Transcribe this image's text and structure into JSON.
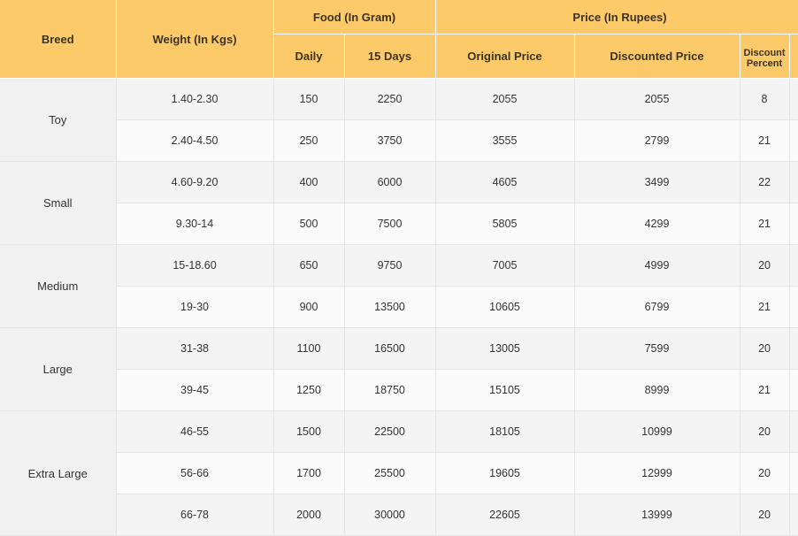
{
  "header": {
    "breed": "Breed",
    "weight": "Weight (In Kgs)",
    "food_group": "Food (In Gram)",
    "price_group": "Price (In Rupees)",
    "daily": "Daily",
    "fifteen_days": "15 Days",
    "original_price": "Original Price",
    "discounted_price": "Discounted Price",
    "discount_percent_line1": "Discount",
    "discount_percent_line2": "Percent"
  },
  "groups": [
    {
      "breed": "Toy",
      "rows": [
        {
          "weight": "1.40-2.30",
          "daily": "150",
          "days15": "2250",
          "original": "2055",
          "discounted": "2055",
          "discount": "8"
        },
        {
          "weight": "2.40-4.50",
          "daily": "250",
          "days15": "3750",
          "original": "3555",
          "discounted": "2799",
          "discount": "21"
        }
      ]
    },
    {
      "breed": "Small",
      "rows": [
        {
          "weight": "4.60-9.20",
          "daily": "400",
          "days15": "6000",
          "original": "4605",
          "discounted": "3499",
          "discount": "22"
        },
        {
          "weight": "9.30-14",
          "daily": "500",
          "days15": "7500",
          "original": "5805",
          "discounted": "4299",
          "discount": "21"
        }
      ]
    },
    {
      "breed": "Medium",
      "rows": [
        {
          "weight": "15-18.60",
          "daily": "650",
          "days15": "9750",
          "original": "7005",
          "discounted": "4999",
          "discount": "20"
        },
        {
          "weight": "19-30",
          "daily": "900",
          "days15": "13500",
          "original": "10605",
          "discounted": "6799",
          "discount": "21"
        }
      ]
    },
    {
      "breed": "Large",
      "rows": [
        {
          "weight": "31-38",
          "daily": "1100",
          "days15": "16500",
          "original": "13005",
          "discounted": "7599",
          "discount": "20"
        },
        {
          "weight": "39-45",
          "daily": "1250",
          "days15": "18750",
          "original": "15105",
          "discounted": "8999",
          "discount": "21"
        }
      ]
    },
    {
      "breed": "Extra Large",
      "rows": [
        {
          "weight": "46-55",
          "daily": "1500",
          "days15": "22500",
          "original": "18105",
          "discounted": "10999",
          "discount": "20"
        },
        {
          "weight": "56-66",
          "daily": "1700",
          "days15": "25500",
          "original": "19605",
          "discounted": "12999",
          "discount": "20"
        },
        {
          "weight": "66-78",
          "daily": "2000",
          "days15": "30000",
          "original": "22605",
          "discounted": "13999",
          "discount": "20"
        }
      ]
    }
  ],
  "colors": {
    "header_bg": "#fdca69",
    "breed_bg": "#f1f1f1",
    "row_odd": "#f4f4f4",
    "row_even": "#fbfbfb"
  }
}
